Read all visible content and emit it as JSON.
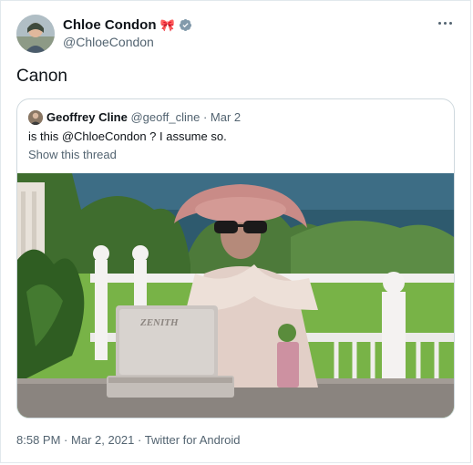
{
  "author": {
    "display_name": "Chloe Condon",
    "name_emoji": "🎀",
    "handle": "@ChloeCondon",
    "verified": true
  },
  "tweet": {
    "text": "Canon",
    "more_icon": "more-horizontal-icon"
  },
  "quoted_tweet": {
    "display_name": "Geoffrey Cline",
    "handle": "@geoff_cline",
    "separator": "·",
    "date": "Mar 2",
    "text": "is this @ChloeCondon ? I assume so.",
    "show_thread_label": "Show this thread",
    "media_brand_text": "ZENITH"
  },
  "footer": {
    "time": "8:58 PM",
    "separator1": "·",
    "date": "Mar 2, 2021",
    "separator2": "·",
    "source": "Twitter for Android"
  },
  "colors": {
    "text_primary": "#0f1419",
    "text_secondary": "#536471",
    "border": "#cfd9de",
    "verified_badge": "#829aab"
  }
}
